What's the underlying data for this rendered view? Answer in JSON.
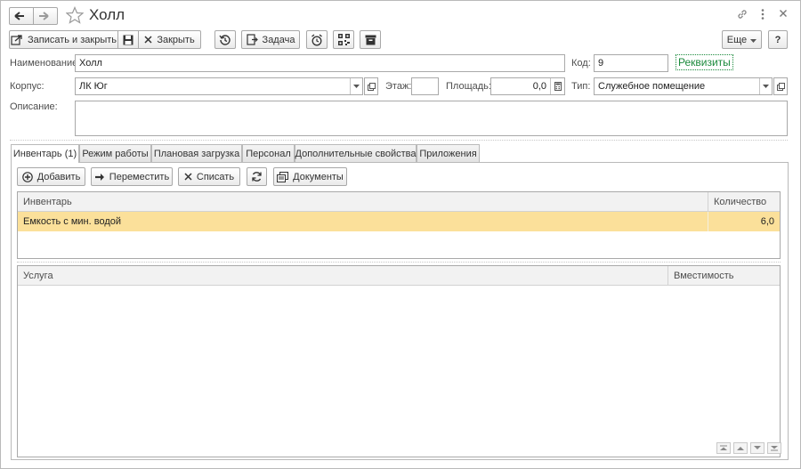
{
  "window": {
    "title": "Холл",
    "more_label": "Еще",
    "help_label": "?"
  },
  "toolbar": {
    "save_close_label": "Записать и закрыть",
    "close_label": "Закрыть",
    "task_label": "Задача"
  },
  "form": {
    "name_label": "Наименование:",
    "name_value": "Холл",
    "code_label": "Код:",
    "code_value": "9",
    "requisites_link": "Реквизиты",
    "building_label": "Корпус:",
    "building_value": "ЛК Юг",
    "floor_label": "Этаж:",
    "floor_value": "",
    "area_label": "Площадь:",
    "area_value": "0,0",
    "type_label": "Тип:",
    "type_value": "Служебное помещение",
    "description_label": "Описание:",
    "description_value": ""
  },
  "tabs": [
    {
      "label": "Инвентарь (1)",
      "active": true
    },
    {
      "label": "Режим работы",
      "active": false
    },
    {
      "label": "Плановая загрузка",
      "active": false
    },
    {
      "label": "Персонал",
      "active": false
    },
    {
      "label": "Дополнительные свойства",
      "active": false
    },
    {
      "label": "Приложения",
      "active": false
    }
  ],
  "inventory_toolbar": {
    "add_label": "Добавить",
    "move_label": "Переместить",
    "writeoff_label": "Списать",
    "documents_label": "Документы"
  },
  "inventory_table": {
    "columns": [
      "Инвентарь",
      "Количество"
    ],
    "rows": [
      {
        "name": "Емкость с мин. водой",
        "quantity": "6,0"
      }
    ]
  },
  "services_table": {
    "columns": [
      "Услуга",
      "Вместимость"
    ],
    "rows": []
  },
  "colors": {
    "selected_row": "#fbe09a",
    "link": "#1b8a3c"
  }
}
